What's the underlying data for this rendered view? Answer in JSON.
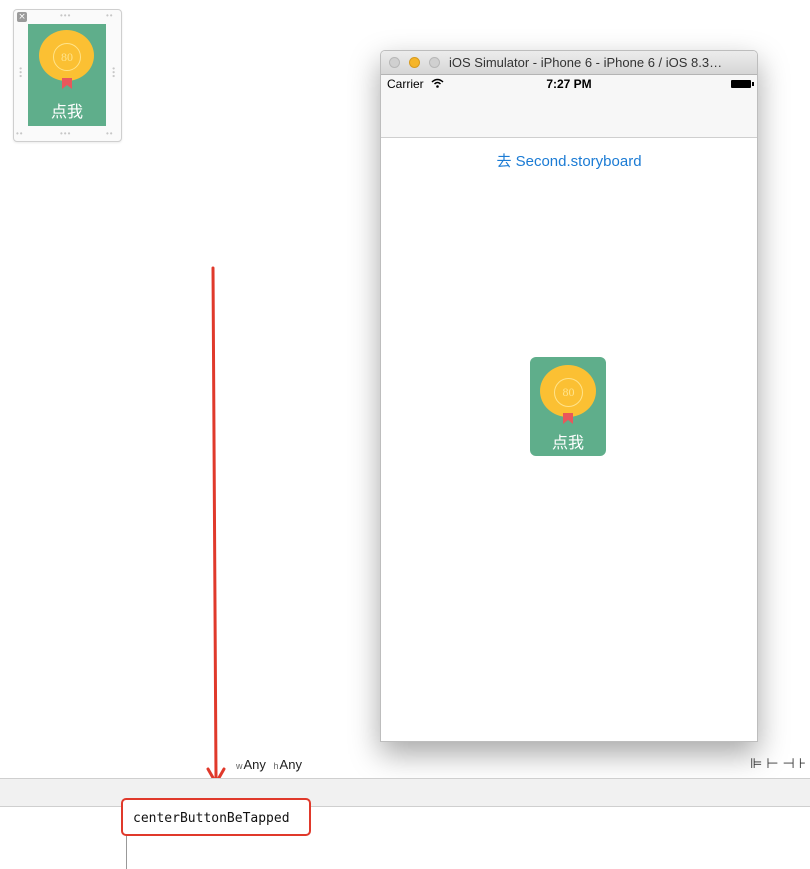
{
  "xib_button": {
    "medal_number": "80",
    "label": "点我"
  },
  "simulator": {
    "window_title": "iOS Simulator - iPhone 6 - iPhone 6 / iOS 8.3…",
    "status": {
      "carrier": "Carrier",
      "time": "7:27 PM"
    },
    "link_button": "去 Second.storyboard",
    "center_button": {
      "medal_number": "80",
      "label": "点我"
    }
  },
  "size_class": {
    "w_prefix": "w",
    "w_value": "Any",
    "h_prefix": "h",
    "h_value": "Any"
  },
  "code": {
    "method_name": "centerButtonBeTapped"
  },
  "colors": {
    "tile_green": "#5fae8b",
    "medal_yellow": "#fbc033",
    "ribbon_red": "#e9575b",
    "link_blue": "#1b7bd4",
    "arrow_red": "#e0392b"
  }
}
